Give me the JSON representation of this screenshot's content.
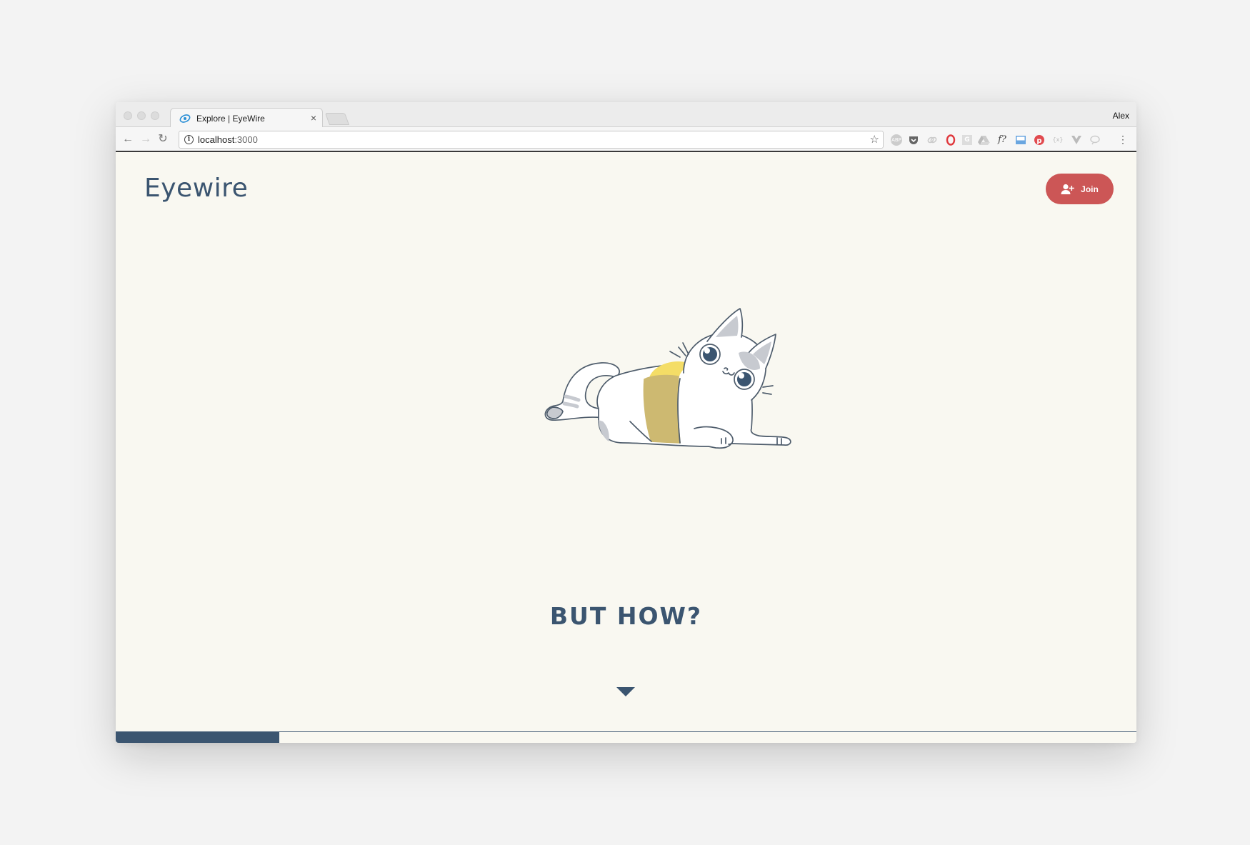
{
  "browser": {
    "tab": {
      "title": "Explore | EyeWire",
      "close_glyph": "×"
    },
    "profile_name": "Alex",
    "address": {
      "host": "localhost",
      "port": ":3000"
    },
    "extensions": [
      "ABP",
      "pocket",
      "link",
      "O",
      "G",
      "drive",
      "f?",
      "img",
      "P",
      "{x}",
      "V",
      "chat"
    ]
  },
  "site": {
    "logo": "Eyewire",
    "join_label": "Join",
    "headline": "BUT HOW?",
    "progress_fraction": 0.16
  },
  "colors": {
    "brand_navy": "#3b5570",
    "join_red": "#cc5656",
    "page_bg": "#f9f8f1",
    "cat_yellow": "#f4dd66",
    "cat_tan": "#cdb971"
  }
}
